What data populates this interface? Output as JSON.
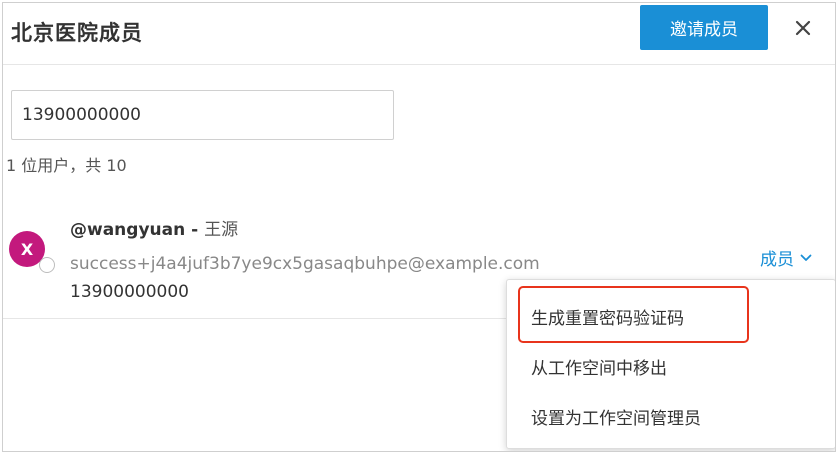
{
  "header": {
    "title": "北京医院成员",
    "invite_label": "邀请成员"
  },
  "search": {
    "value": "13900000000"
  },
  "results": {
    "count_text": "1 位用户，共 10"
  },
  "member": {
    "avatar_letter": "X",
    "username": "@wangyuan",
    "separator": " - ",
    "realname": "王源",
    "email": "success+j4a4juf3b7ye9cx5gasaqbuhpe@example.com",
    "phone": "13900000000",
    "role": "成员"
  },
  "menu": {
    "items": [
      {
        "label": "生成重置密码验证码"
      },
      {
        "label": "从工作空间中移出"
      },
      {
        "label": "设置为工作空间管理员"
      }
    ]
  },
  "colors": {
    "accent": "#1a8fd6",
    "avatar_bg": "#c3197d",
    "highlight": "#e8341c"
  },
  "icons": {
    "close": "close-icon",
    "role_dropdown": "chevron-down-icon",
    "status": "status-dot-icon"
  }
}
